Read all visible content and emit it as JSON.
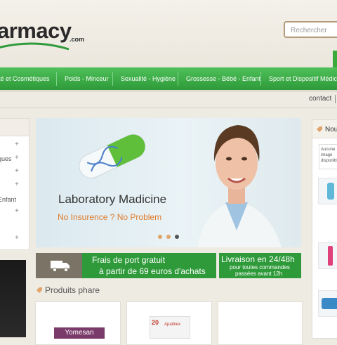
{
  "header": {
    "logo_text": "armacy",
    "logo_suffix": ".com",
    "search_placeholder": "Rechercher"
  },
  "nav": {
    "items": [
      "té et Cosmétiques",
      "Poids - Minceur",
      "Sexualité - Hygiène",
      "Grossesse - Bébé - Enfant",
      "Sport et Dispositif Médical"
    ]
  },
  "topbar": {
    "contact": "contact"
  },
  "sidebar": {
    "items": [
      "",
      "ques",
      "",
      "",
      "Enfant",
      "",
      ""
    ]
  },
  "banner": {
    "title": "Laboratory Madicine",
    "subtitle": "No Insurence ? No Problem",
    "active_dot": 2
  },
  "promo": {
    "shipping_line1": "Frais de port gratuit",
    "shipping_line2": "à partir de 69 euros d'achats",
    "delivery_title": "Livraison en 24/48h",
    "delivery_line1": "pour toutes commandes",
    "delivery_line2": "passées avant 12h"
  },
  "products": {
    "heading": "Produits phare",
    "items": [
      {
        "brand": "Yomesan"
      },
      {
        "brand": "Apaiblex"
      },
      {
        "brand": ""
      }
    ]
  },
  "right_panel": {
    "heading": "Nou",
    "no_image_text": "Aucune image disponibl"
  },
  "colors": {
    "nav_green": "#2e9a3a",
    "accent_orange": "#e07a2a",
    "page_bg": "#eeebe3"
  }
}
